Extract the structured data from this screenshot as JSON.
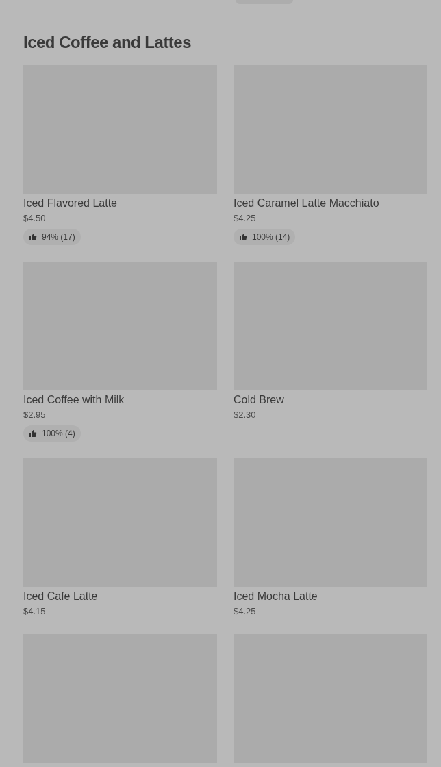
{
  "section": {
    "title": "Iced Coffee and Lattes"
  },
  "items": [
    {
      "kind": "product",
      "name": "Iced Flavored Latte",
      "price": "$4.50",
      "rating": "94% (17)"
    },
    {
      "kind": "product",
      "name": "Iced Caramel Latte Macchiato",
      "price": "$4.25",
      "rating": "100% (14)"
    },
    {
      "kind": "product",
      "name": "Iced Coffee with Milk",
      "price": "$2.95",
      "rating": "100% (4)"
    },
    {
      "kind": "product",
      "name": "Cold Brew",
      "price": "$2.30"
    },
    {
      "kind": "product",
      "name": "Iced Cafe Latte",
      "price": "$4.15"
    },
    {
      "kind": "product",
      "name": "Iced Mocha Latte",
      "price": "$4.25"
    },
    {
      "kind": "picture"
    },
    {
      "kind": "picture"
    }
  ]
}
